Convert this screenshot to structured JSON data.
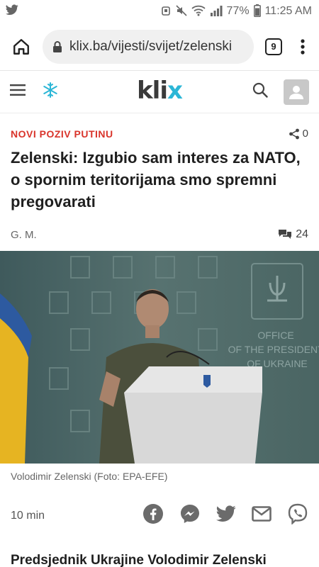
{
  "statusbar": {
    "app_icon": "twitter-icon",
    "battery": "77%",
    "time": "11:25 AM"
  },
  "browser": {
    "url": "klix.ba/vijesti/svijet/zelenski",
    "tab_count": "9"
  },
  "site": {
    "logo_main": "kli",
    "logo_accent": "x",
    "accent_color": "#2bb6d6"
  },
  "article": {
    "category": "NOVI POZIV PUTINU",
    "share_count": "0",
    "title": "Zelenski: Izgubio sam interes za NATO, o spornim teritorijama smo spremni pregovarati",
    "author": "G. M.",
    "comment_count": "24",
    "photo_text": "OFFICE\nOF THE PRESIDENT\nOF UKRAINE",
    "caption": "Volodimir Zelenski (Foto: EPA-EFE)",
    "read_time": "10 min",
    "lead": "Predsjednik Ukrajine Volodimir Zelenski ponovno je pozvao ruskog predsjednika"
  }
}
